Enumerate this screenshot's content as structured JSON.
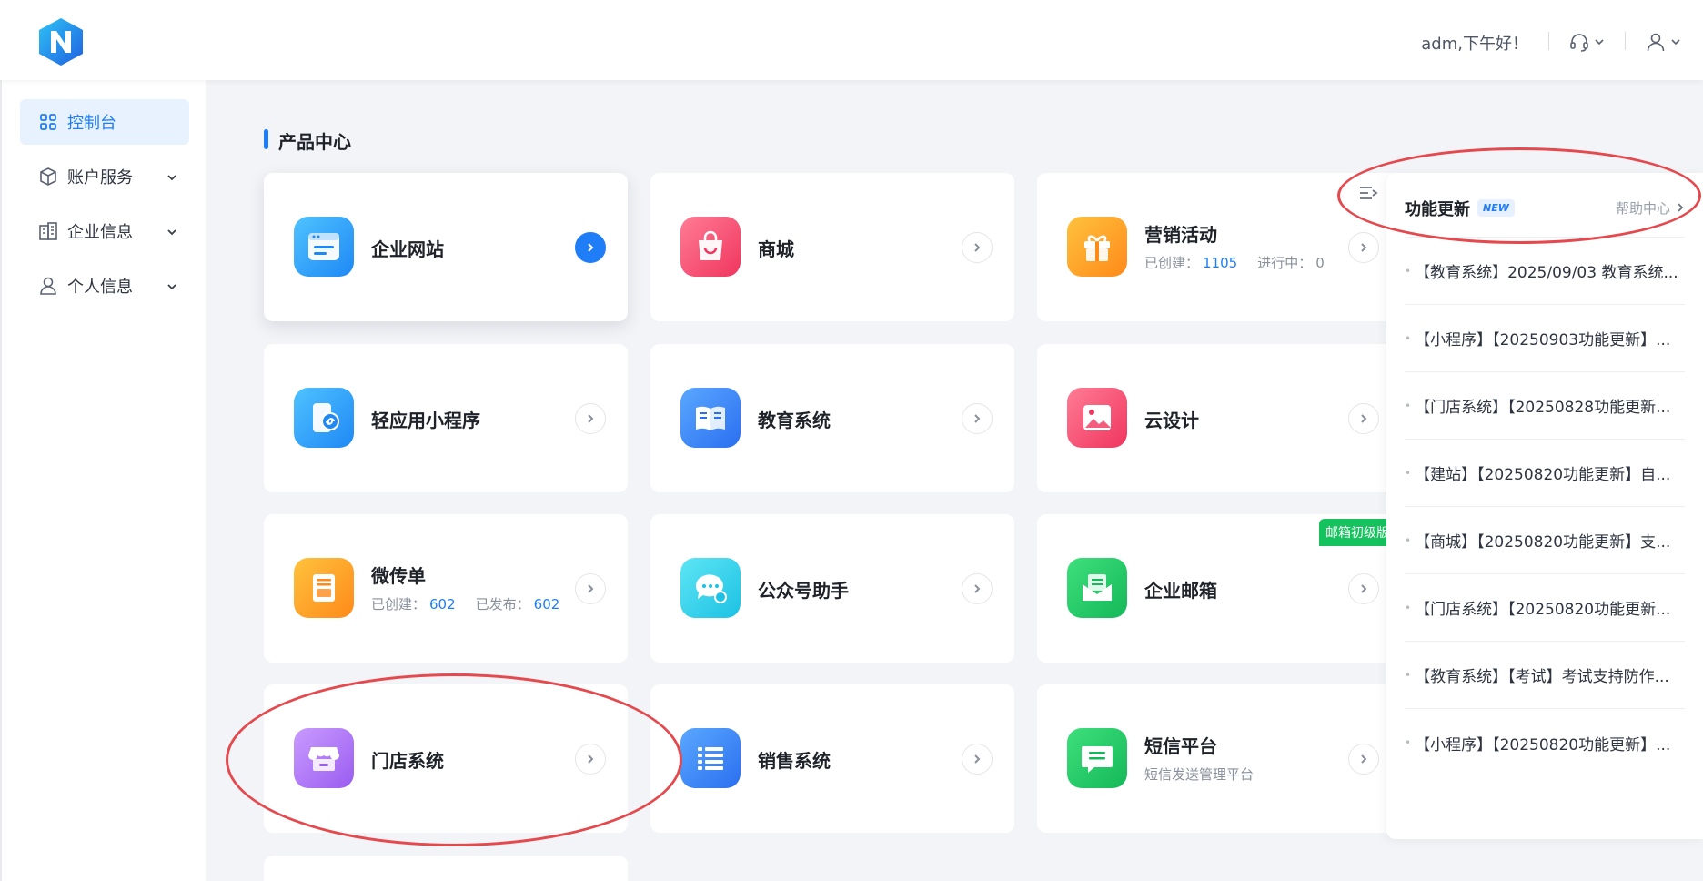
{
  "header": {
    "greeting": "adm,下午好！"
  },
  "sidebar": {
    "items": [
      {
        "label": "控制台",
        "active": true
      },
      {
        "label": "账户服务"
      },
      {
        "label": "企业信息"
      },
      {
        "label": "个人信息"
      }
    ]
  },
  "main": {
    "section_title": "产品中心",
    "cards": [
      {
        "name": "企业网站"
      },
      {
        "name": "商城"
      },
      {
        "name": "营销活动",
        "stat1_label": "已创建：",
        "stat1_value": "1105",
        "stat2_label": "进行中：",
        "stat2_value": "0"
      },
      {
        "name": "轻应用小程序"
      },
      {
        "name": "教育系统"
      },
      {
        "name": "云设计"
      },
      {
        "name": "微传单",
        "stat1_label": "已创建：",
        "stat1_value": "602",
        "stat2_label": "已发布：",
        "stat2_value": "602"
      },
      {
        "name": "公众号助手"
      },
      {
        "name": "企业邮箱",
        "badge": "邮箱初级版"
      },
      {
        "name": "门店系统"
      },
      {
        "name": "销售系统"
      },
      {
        "name": "短信平台",
        "desc": "短信发送管理平台"
      }
    ]
  },
  "panel": {
    "title": "功能更新",
    "new_badge": "NEW",
    "help_link": "帮助中心",
    "news": [
      "【教育系统】2025/09/03 教育系统...",
      "【小程序】【20250903功能更新】...",
      "【门店系统】【20250828功能更新...",
      "【建站】【20250820功能更新】自...",
      "【商城】【20250820功能更新】支...",
      "【门店系统】【20250820功能更新...",
      "【教育系统】【考试】考试支持防作...",
      "【小程序】【20250820功能更新】..."
    ]
  },
  "colors": {
    "accent": "#1f7ef7",
    "annotation": "#e5484d"
  }
}
